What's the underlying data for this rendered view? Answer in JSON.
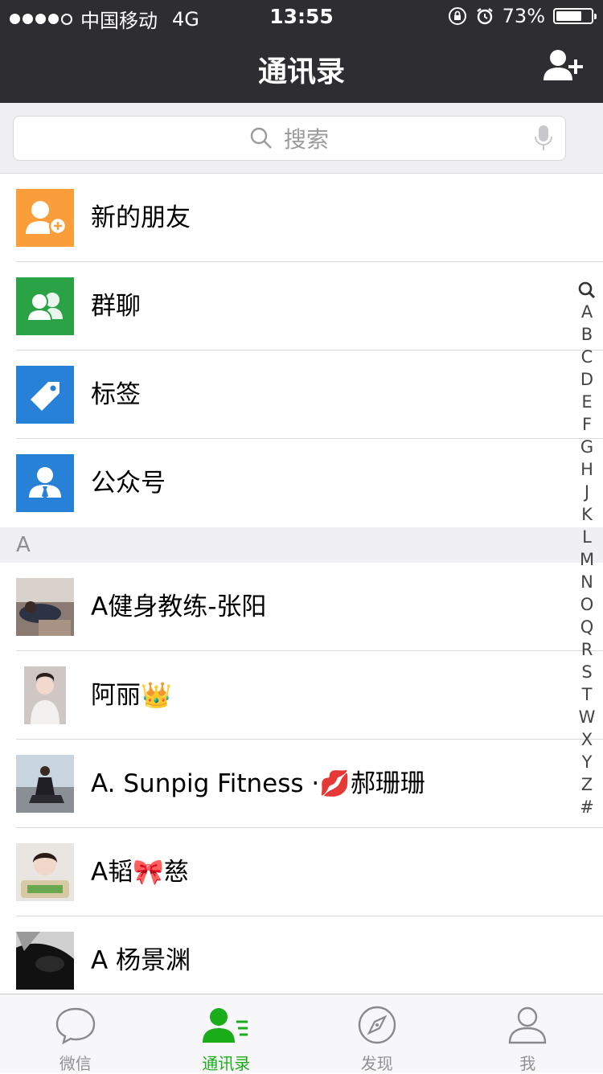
{
  "status": {
    "carrier": "中国移动",
    "network": "4G",
    "time": "13:55",
    "battery": "73%",
    "battery_level": 0.73
  },
  "nav": {
    "title": "通讯录"
  },
  "search": {
    "placeholder": "搜索"
  },
  "functions": [
    {
      "label": "新的朋友",
      "icon": "new-friend-icon",
      "color": "#fa9d3b"
    },
    {
      "label": "群聊",
      "icon": "group-chat-icon",
      "color": "#2ba245"
    },
    {
      "label": "标签",
      "icon": "tag-icon",
      "color": "#2782d7"
    },
    {
      "label": "公众号",
      "icon": "official-account-icon",
      "color": "#2782d7"
    }
  ],
  "section_a": "A",
  "contacts": [
    {
      "name": "A健身教练-张阳",
      "avatar": "avatar-photo"
    },
    {
      "name": "阿丽👑",
      "avatar": "avatar-photo"
    },
    {
      "name": "A. Sunpig Fitness ·💋郝珊珊",
      "avatar": "avatar-photo"
    },
    {
      "name": "A韬🎀慈",
      "avatar": "avatar-photo"
    },
    {
      "name": "A   杨景渊",
      "avatar": "avatar-photo"
    }
  ],
  "index_letters": [
    "A",
    "B",
    "C",
    "D",
    "E",
    "F",
    "G",
    "H",
    "J",
    "K",
    "L",
    "M",
    "N",
    "O",
    "Q",
    "R",
    "S",
    "T",
    "W",
    "X",
    "Y",
    "Z",
    "#"
  ],
  "tabs": [
    {
      "label": "微信",
      "icon": "chat-bubble-icon"
    },
    {
      "label": "通讯录",
      "icon": "contacts-icon",
      "active": true
    },
    {
      "label": "发现",
      "icon": "compass-icon"
    },
    {
      "label": "我",
      "icon": "person-icon"
    }
  ],
  "colors": {
    "accent": "#1aad19",
    "navbar": "#2e2d32"
  }
}
